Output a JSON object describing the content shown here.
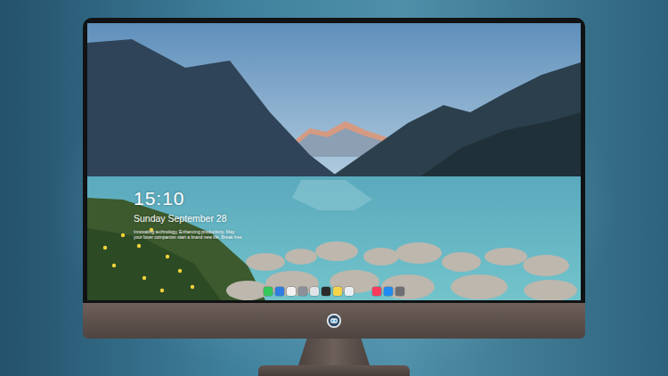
{
  "lock_screen": {
    "time": "15:10",
    "date": "Sunday September 28",
    "tagline_lines": [
      "Innovating technology, Enhancing productivity. May",
      "your lover companion start a brand new life. Break free"
    ]
  },
  "dock": {
    "apps": [
      {
        "color": "#34c759"
      },
      {
        "color": "#2f7de1"
      },
      {
        "color": "#f2f2f2"
      },
      {
        "color": "#8a8f98"
      },
      {
        "color": "#dfe3e8"
      },
      {
        "color": "#2b2b2b"
      },
      {
        "color": "#f5d547"
      },
      {
        "color": "#e9eef2"
      },
      {
        "color": "#fc3c5a"
      },
      {
        "color": "#1e8cf0"
      },
      {
        "color": "#6e6e73"
      }
    ]
  }
}
